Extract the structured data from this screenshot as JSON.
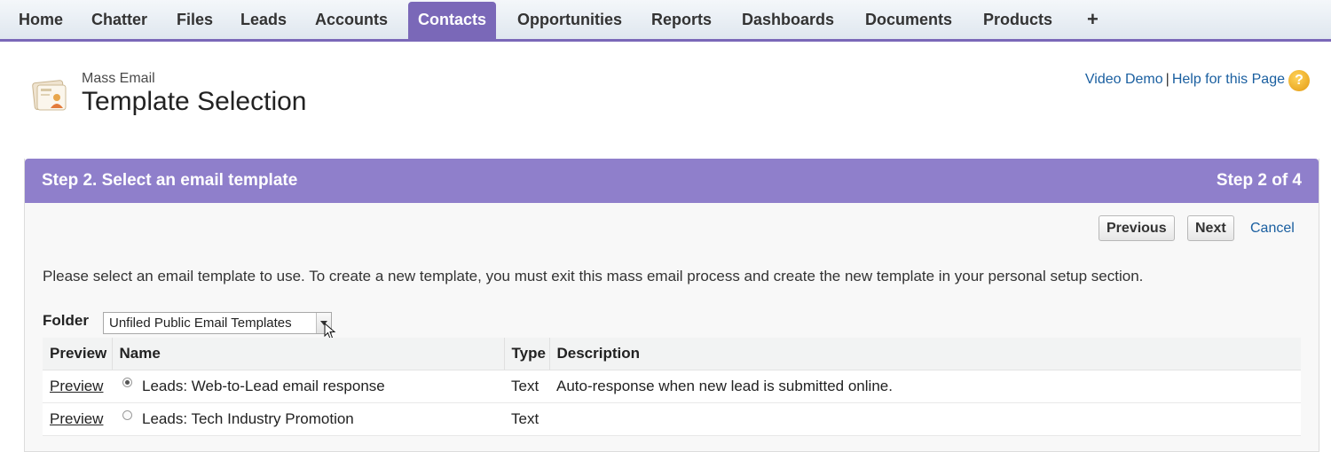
{
  "nav": {
    "tabs": [
      "Home",
      "Chatter",
      "Files",
      "Leads",
      "Accounts",
      "Contacts",
      "Opportunities",
      "Reports",
      "Dashboards",
      "Documents",
      "Products"
    ],
    "active_tab": "Contacts",
    "add_tab_glyph": "+"
  },
  "header": {
    "eyebrow": "Mass Email",
    "title": "Template Selection",
    "video_demo": "Video Demo",
    "separator": "|",
    "help_link": "Help for this Page",
    "help_icon_glyph": "?"
  },
  "step": {
    "title": "Step 2. Select an email template",
    "count": "Step 2 of 4",
    "previous_label": "Previous",
    "next_label": "Next",
    "cancel_label": "Cancel",
    "instructions": "Please select an email template to use. To create a new template, you must exit this mass email process and create the new template in your personal setup section."
  },
  "folder": {
    "label": "Folder",
    "selected": "Unfiled Public Email Templates"
  },
  "table": {
    "headers": {
      "preview": "Preview",
      "name": "Name",
      "type": "Type",
      "description": "Description"
    },
    "rows": [
      {
        "preview": "Preview",
        "name": "Leads: Web-to-Lead email response",
        "type": "Text",
        "description": "Auto-response when new lead is submitted online.",
        "selected": true
      },
      {
        "preview": "Preview",
        "name": "Leads: Tech Industry Promotion",
        "type": "Text",
        "description": "",
        "selected": false
      }
    ]
  },
  "colors": {
    "accent": "#7a68b8",
    "step_header": "#8f7fcb",
    "link": "#1a5fa0"
  },
  "icons": {
    "page": "email-template-icon",
    "help": "help-icon",
    "add_tab": "plus-icon",
    "dropdown": "chevron-down-icon",
    "cursor": "mouse-cursor-icon"
  }
}
